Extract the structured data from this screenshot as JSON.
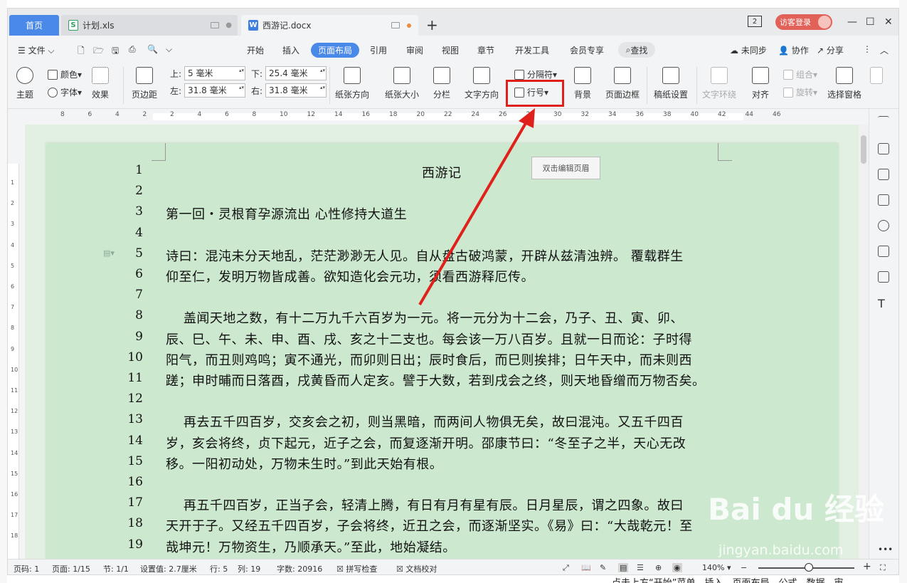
{
  "tabs": {
    "home": "首页",
    "xls": "计划.xls",
    "doc": "西游记.docx"
  },
  "titlebar": {
    "num_badge": "2",
    "login": "访客登录"
  },
  "menu": {
    "file": "文件",
    "items": [
      "开始",
      "插入",
      "页面布局",
      "引用",
      "审阅",
      "视图",
      "章节",
      "开发工具",
      "会员专享"
    ],
    "find": "查找",
    "sync": "未同步",
    "collab": "协作",
    "share": "分享"
  },
  "ribbon": {
    "theme": "主题",
    "color": "颜色",
    "font": "字体",
    "effect": "效果",
    "margins": "页边距",
    "top_label": "上:",
    "top_value": "5 毫米",
    "bottom_label": "下:",
    "bottom_value": "25.4 毫米",
    "left_label": "左:",
    "left_value": "31.8 毫米",
    "right_label": "右:",
    "right_value": "31.8 毫米",
    "orientation": "纸张方向",
    "size": "纸张大小",
    "columns": "分栏",
    "text_direction": "文字方向",
    "breaks": "分隔符",
    "line_numbers": "行号",
    "background": "背景",
    "page_border": "页面边框",
    "manuscript": "稿纸设置",
    "wrap": "文字环绕",
    "align": "对齐",
    "group": "组合",
    "rotate": "旋转",
    "select_pane": "选择窗格"
  },
  "ruler": {
    "h": [
      "8",
      "6",
      "4",
      "2",
      "2",
      "4",
      "6",
      "8",
      "10",
      "12",
      "14",
      "16",
      "18",
      "20",
      "22",
      "24",
      "26",
      "28",
      "30",
      "32",
      "34",
      "36",
      "38",
      "40",
      "42",
      "44",
      "46"
    ],
    "v": [
      "1",
      "2",
      "3",
      "4",
      "5",
      "6",
      "7",
      "8",
      "9",
      "10",
      "11",
      "12",
      "13",
      "14",
      "15",
      "16",
      "17",
      "18"
    ]
  },
  "tooltip": "双击编辑页眉",
  "document": {
    "title": "西游记",
    "lines": [
      {
        "n": "1",
        "t": ""
      },
      {
        "n": "2",
        "t": ""
      },
      {
        "n": "3",
        "t": "第一回・灵根育孕源流出 心性修持大道生"
      },
      {
        "n": "4",
        "t": ""
      },
      {
        "n": "5",
        "t": "诗曰：混沌未分天地乱，茫茫渺渺无人见。自从盘古破鸿蒙，开辟从兹清浊辨。 覆载群生"
      },
      {
        "n": "6",
        "t": "仰至仁，发明万物皆成善。欲知造化会元功，须看西游释厄传。"
      },
      {
        "n": "7",
        "t": ""
      },
      {
        "n": "8",
        "t": "    盖闻天地之数，有十二万九千六百岁为一元。将一元分为十二会，乃子、丑、寅、卯、"
      },
      {
        "n": "9",
        "t": "辰、巳、午、未、申、酉、戌、亥之十二支也。每会该一万八百岁。且就一日而论：子时得"
      },
      {
        "n": "10",
        "t": "阳气，而丑则鸡鸣；寅不通光，而卯则日出；辰时食后，而巳则挨排；日午天中，而未则西"
      },
      {
        "n": "11",
        "t": "蹉；申时晡而日落酉，戌黄昏而人定亥。譬于大数，若到戌会之终，则天地昏缯而万物否矣。"
      },
      {
        "n": "12",
        "t": ""
      },
      {
        "n": "13",
        "t": "    再去五千四百岁，交亥会之初，则当黑暗，而两间人物俱无矣，故曰混沌。又五千四百"
      },
      {
        "n": "14",
        "t": "岁，亥会将终，贞下起元，近子之会，而复逐渐开明。邵康节曰：“冬至子之半，天心无改"
      },
      {
        "n": "15",
        "t": "移。一阳初动处，万物未生时。”到此天始有根。"
      },
      {
        "n": "16",
        "t": ""
      },
      {
        "n": "17",
        "t": "    再五千四百岁，正当子会，轻清上腾，有日有月有星有辰。日月星辰，谓之四象。故曰"
      },
      {
        "n": "18",
        "t": "天开于子。又经五千四百岁，子会将终，近丑之会，而逐渐坚实。《易》曰：“大哉乾元！至"
      },
      {
        "n": "19",
        "t": "哉坤元！万物资生，乃顺承天。”至此，地始凝结。"
      }
    ]
  },
  "status": {
    "page_code": "页码: 1",
    "page": "页面: 1/15",
    "section": "节: 1/1",
    "setting": "设置值: 2.7厘米",
    "row": "行: 5",
    "col": "列: 19",
    "words": "字数: 20916",
    "spell": "拼写检查",
    "proof": "文档校对",
    "zoom": "140%"
  },
  "watermark": {
    "brand": "Bai du 经验",
    "url": "jingyan.baidu.com"
  },
  "outside_text": "点击上方“开始”菜单，插入、页面布局、公式、数据、审",
  "colors": {
    "accent": "#4a89e8",
    "highlight": "#e0201a",
    "page_bg": "#cce8cf"
  }
}
